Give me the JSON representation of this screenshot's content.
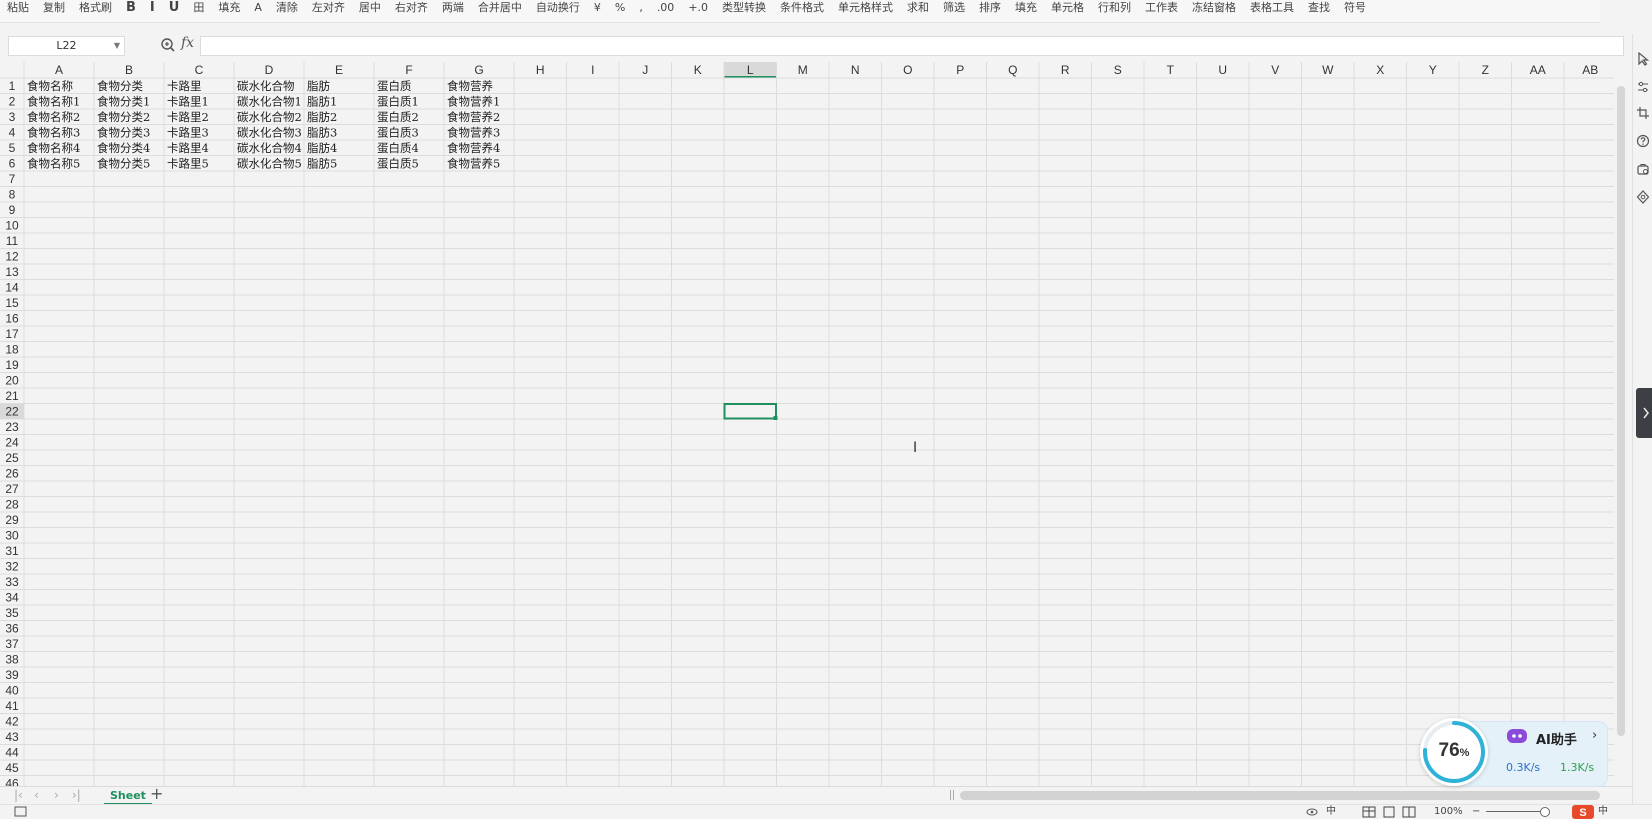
{
  "toolbar": {
    "items": [
      "粘贴",
      "复制",
      "格式刷",
      "B",
      "I",
      "U",
      "田",
      "填充",
      "A",
      "清除",
      "左对齐",
      "居中",
      "右对齐",
      "两端",
      "合并居中",
      "自动换行",
      "¥",
      "%",
      ",",
      ".00",
      "+.0",
      "类型转换",
      "条件格式",
      "单元格样式",
      "求和",
      "筛选",
      "排序",
      "填充",
      "单元格",
      "行和列",
      "工作表",
      "冻结窗格",
      "表格工具",
      "查找",
      "符号"
    ]
  },
  "formula_bar": {
    "name_box": "L22",
    "fx_label": "fx",
    "formula_value": ""
  },
  "sheet": {
    "active_cell": "L22",
    "columns": [
      "A",
      "B",
      "C",
      "D",
      "E",
      "F",
      "G",
      "H",
      "I",
      "J",
      "K",
      "L",
      "M",
      "N",
      "O",
      "P",
      "Q",
      "R",
      "S",
      "T",
      "U",
      "V",
      "W",
      "X",
      "Y",
      "Z",
      "AA",
      "AB"
    ],
    "rows_visible": 46,
    "data_rows": [
      [
        "食物名称",
        "食物分类",
        "卡路里",
        "碳水化合物",
        "脂肪",
        "蛋白质",
        "食物营养"
      ],
      [
        "食物名称1",
        "食物分类1",
        "卡路里1",
        "碳水化合物1",
        "脂肪1",
        "蛋白质1",
        "食物营养1"
      ],
      [
        "食物名称2",
        "食物分类2",
        "卡路里2",
        "碳水化合物2",
        "脂肪2",
        "蛋白质2",
        "食物营养2"
      ],
      [
        "食物名称3",
        "食物分类3",
        "卡路里3",
        "碳水化合物3",
        "脂肪3",
        "蛋白质3",
        "食物营养3"
      ],
      [
        "食物名称4",
        "食物分类4",
        "卡路里4",
        "碳水化合物4",
        "脂肪4",
        "蛋白质4",
        "食物营养4"
      ],
      [
        "食物名称5",
        "食物分类5",
        "卡路里5",
        "碳水化合物5",
        "脂肪5",
        "蛋白质5",
        "食物营养5"
      ]
    ]
  },
  "tabs": {
    "sheet_name": "Sheet",
    "add_label": "+"
  },
  "status_bar": {
    "zoom": "100%"
  },
  "ai_widget": {
    "progress_value": "76",
    "progress_unit": "%",
    "progress_fraction": 0.76,
    "label": "AI助手",
    "metric1": "0.3K/s",
    "metric2": "1.3K/s"
  },
  "colors": {
    "active_cell_border": "#1f8f5f",
    "header_bg": "#f3f3f3",
    "grid_line": "#dcdcdc",
    "active_header_bg": "#d9d9d9"
  }
}
